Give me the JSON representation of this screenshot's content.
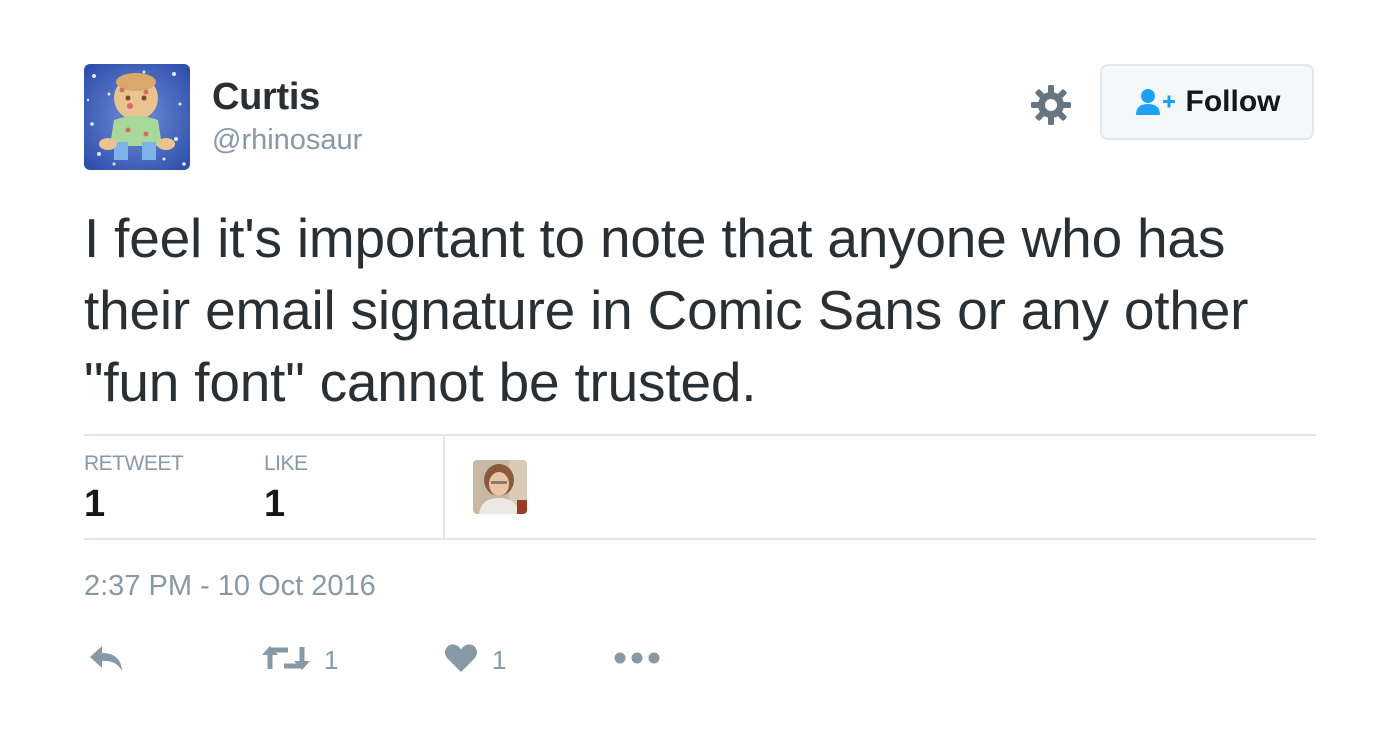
{
  "author": {
    "name": "Curtis",
    "handle": "@rhinosaur"
  },
  "follow_button": {
    "label": "Follow",
    "icon": "add-user-icon"
  },
  "settings": {
    "icon": "gear-icon"
  },
  "tweet": {
    "text": "I feel it's important to note that anyone who has their email signature in Comic Sans or any other \"fun font\" cannot be trusted.",
    "timestamp": "2:37 PM - 10 Oct 2016"
  },
  "stats": {
    "retweet_label": "RETWEET",
    "retweet_count": "1",
    "like_label": "LIKE",
    "like_count": "1"
  },
  "actions": {
    "reply_icon": "reply-icon",
    "retweet_icon": "retweet-icon",
    "retweet_count": "1",
    "like_icon": "heart-icon",
    "like_count": "1",
    "more_icon": "more-icon"
  },
  "colors": {
    "text": "#292f33",
    "muted": "#8899a6",
    "accent": "#1da1f2",
    "divider": "#e1e8ed"
  }
}
